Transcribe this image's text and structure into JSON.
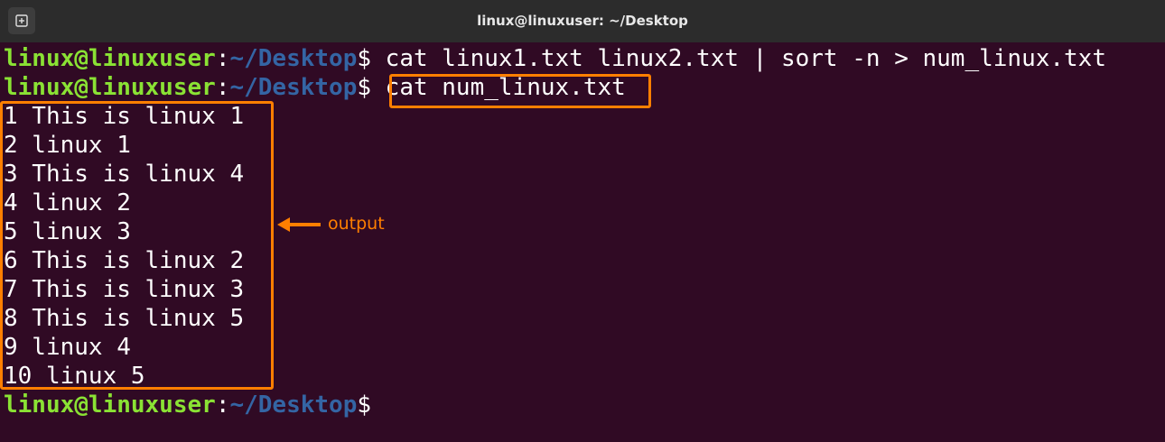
{
  "window": {
    "title": "linux@linuxuser: ~/Desktop",
    "new_tab_icon": "new-tab-icon"
  },
  "prompt": {
    "user": "linux@linuxuser",
    "sep": ":",
    "path": "~/Desktop",
    "dollar": "$"
  },
  "commands": [
    " cat linux1.txt linux2.txt | sort -n > num_linux.txt",
    " cat num_linux.txt"
  ],
  "output_lines": [
    "1 This is linux 1",
    "2 linux 1",
    "3 This is linux 4",
    "4 linux 2",
    "5 linux 3",
    "6 This is linux 2",
    "7 This is linux 3",
    "8 This is linux 5",
    "9 linux 4",
    "10 linux 5"
  ],
  "annotation": {
    "label": "output",
    "color": "#ff7f00"
  },
  "colors": {
    "background": "#300a24",
    "titlebar": "#2c2c2c",
    "user": "#8ae234",
    "path": "#3465a4"
  }
}
